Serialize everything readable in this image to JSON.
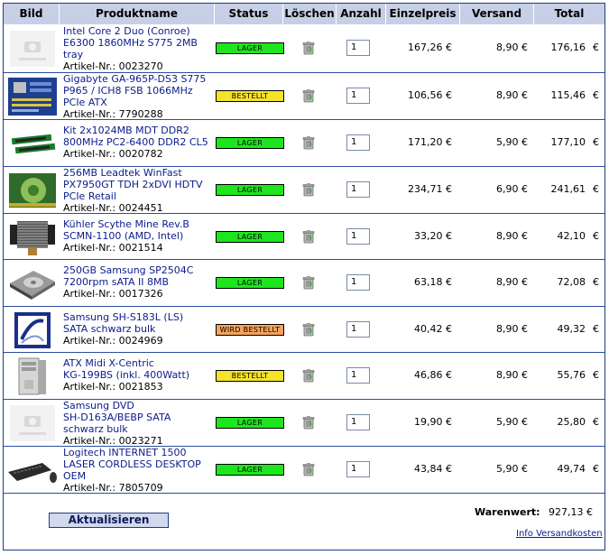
{
  "header": {
    "columns": [
      "Bild",
      "Produktname",
      "Status",
      "Löschen",
      "Anzahl",
      "Einzelpreis",
      "Versand",
      "Total"
    ]
  },
  "status_colors": {
    "LAGER": "#1ee61e",
    "BESTELLT": "#f5e32a",
    "WIRD BESTELLT": "#f4a35c"
  },
  "items": [
    {
      "image_icon": "no-image-placeholder",
      "name_lines": [
        "Intel Core 2 Duo (Conroe)",
        "E6300 1860MHz S775 2MB",
        "tray"
      ],
      "article": "Artikel-Nr.: 0023270",
      "status": "LAGER",
      "quantity": "1",
      "unit_price": "167,26 €",
      "shipping": "8,90 €",
      "total": "176,16",
      "currency": "€"
    },
    {
      "image_icon": "motherboard-image",
      "name_lines": [
        "Gigabyte GA-965P-DS3 S775",
        "P965 / ICH8 FSB 1066MHz",
        "PCIe ATX"
      ],
      "article": "Artikel-Nr.: 7790288",
      "status": "BESTELLT",
      "quantity": "1",
      "unit_price": "106,56 €",
      "shipping": "8,90 €",
      "total": "115,46",
      "currency": "€"
    },
    {
      "image_icon": "ram-image",
      "name_lines": [
        "Kit 2x1024MB MDT DDR2",
        "800MHz PC2-6400 DDR2 CL5"
      ],
      "article": "Artikel-Nr.: 0020782",
      "status": "LAGER",
      "quantity": "1",
      "unit_price": "171,20 €",
      "shipping": "5,90 €",
      "total": "177,10",
      "currency": "€"
    },
    {
      "image_icon": "graphics-card-image",
      "name_lines": [
        "256MB Leadtek WinFast",
        "PX7950GT TDH 2xDVI HDTV",
        "PCIe Retail"
      ],
      "article": "Artikel-Nr.: 0024451",
      "status": "LAGER",
      "quantity": "1",
      "unit_price": "234,71 €",
      "shipping": "6,90 €",
      "total": "241,61",
      "currency": "€"
    },
    {
      "image_icon": "cpu-cooler-image",
      "name_lines": [
        "Kühler Scythe Mine Rev.B",
        "SCMN-1100 (AMD, Intel)"
      ],
      "article": "Artikel-Nr.: 0021514",
      "status": "LAGER",
      "quantity": "1",
      "unit_price": "33,20 €",
      "shipping": "8,90 €",
      "total": "42,10",
      "currency": "€"
    },
    {
      "image_icon": "hard-drive-image",
      "name_lines": [
        "250GB Samsung SP2504C",
        "7200rpm sATA II 8MB"
      ],
      "article": "Artikel-Nr.: 0017326",
      "status": "LAGER",
      "quantity": "1",
      "unit_price": "63,18 €",
      "shipping": "8,90 €",
      "total": "72,08",
      "currency": "€"
    },
    {
      "image_icon": "samsung-logo-image",
      "name_lines": [
        "Samsung SH-S183L (LS)",
        "SATA schwarz bulk"
      ],
      "article": "Artikel-Nr.: 0024969",
      "status": "WIRD BESTELLT",
      "quantity": "1",
      "unit_price": "40,42 €",
      "shipping": "8,90 €",
      "total": "49,32",
      "currency": "€"
    },
    {
      "image_icon": "pc-case-image",
      "name_lines": [
        "ATX Midi X-Centric",
        "KG-199BS (inkl. 400Watt)"
      ],
      "article": "Artikel-Nr.: 0021853",
      "status": "BESTELLT",
      "quantity": "1",
      "unit_price": "46,86 €",
      "shipping": "8,90 €",
      "total": "55,76",
      "currency": "€"
    },
    {
      "image_icon": "no-image-placeholder",
      "name_lines": [
        "Samsung DVD",
        "SH-D163A/BEBP SATA",
        "schwarz bulk"
      ],
      "article": "Artikel-Nr.: 0023271",
      "status": "LAGER",
      "quantity": "1",
      "unit_price": "19,90 €",
      "shipping": "5,90 €",
      "total": "25,80",
      "currency": "€"
    },
    {
      "image_icon": "keyboard-mouse-image",
      "name_lines": [
        "Logitech INTERNET 1500",
        "LASER CORDLESS DESKTOP",
        "OEM"
      ],
      "article": "Artikel-Nr.: 7805709",
      "status": "LAGER",
      "quantity": "1",
      "unit_price": "43,84 €",
      "shipping": "5,90 €",
      "total": "49,74",
      "currency": "€"
    }
  ],
  "footer": {
    "goods_value_label": "Warenwert:",
    "goods_value": "927,13 €",
    "update_button": "Aktualisieren",
    "shipping_info_link": "Info Versandkosten"
  }
}
